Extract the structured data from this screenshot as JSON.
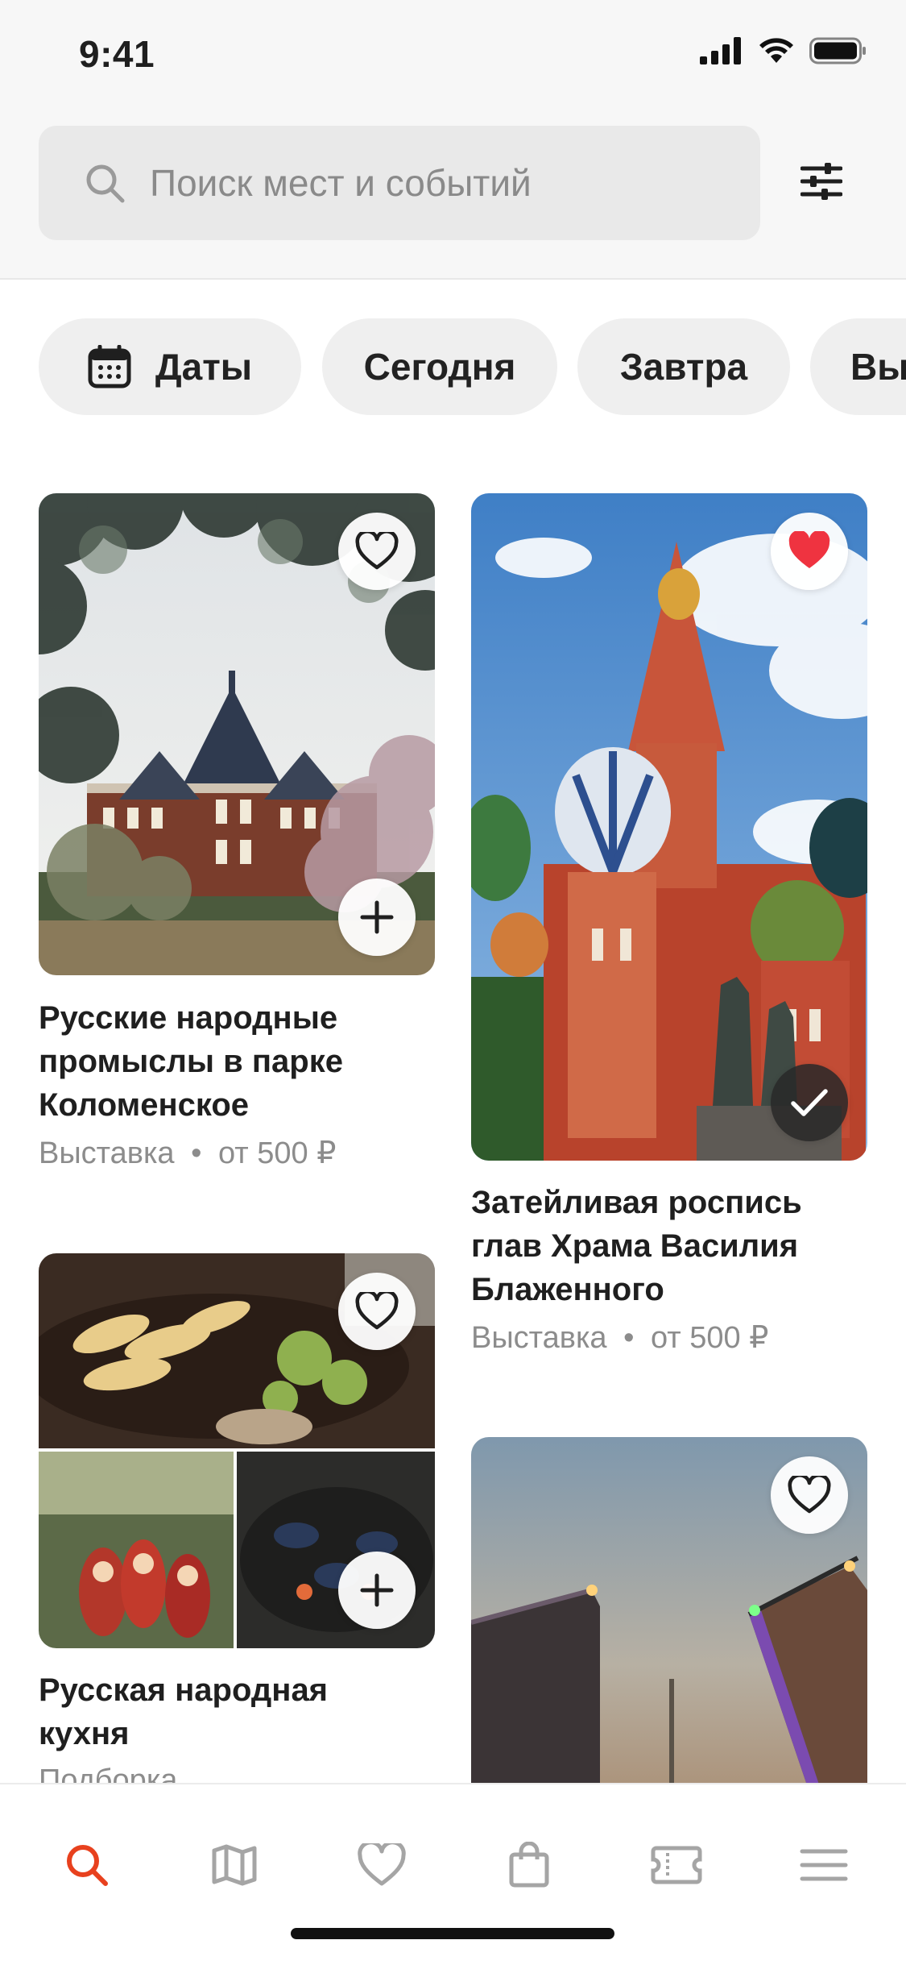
{
  "status_bar": {
    "time": "9:41"
  },
  "search": {
    "placeholder": "Поиск мест и событий"
  },
  "filters": {
    "chips": [
      {
        "label": "Даты",
        "icon": "calendar-icon"
      },
      {
        "label": "Сегодня"
      },
      {
        "label": "Завтра"
      },
      {
        "label": "Вых"
      }
    ]
  },
  "cards": [
    {
      "title_lines": [
        "Русские народные",
        "промыслы в парке",
        "Коломенское"
      ],
      "type": "Выставка",
      "price": "от 500 ₽",
      "favorite": false,
      "action": "add"
    },
    {
      "title_lines": [
        "Затейливая роспись",
        "глав Храма Василия",
        "Блаженного"
      ],
      "type": "Выставка",
      "price": "от 500 ₽",
      "favorite": true,
      "action": "added"
    },
    {
      "title_lines": [
        "Русская народная",
        "кухня"
      ],
      "type": "Подборка",
      "favorite": false,
      "action": "add"
    },
    {
      "favorite": false
    }
  ],
  "separator": "•",
  "tabbar": {
    "items": [
      {
        "name": "search",
        "icon": "search-icon",
        "active": true
      },
      {
        "name": "map",
        "icon": "map-icon"
      },
      {
        "name": "favorites",
        "icon": "heart-icon"
      },
      {
        "name": "cart",
        "icon": "bag-icon"
      },
      {
        "name": "tickets",
        "icon": "ticket-icon"
      },
      {
        "name": "menu",
        "icon": "menu-icon"
      }
    ]
  },
  "colors": {
    "accent": "#e8411e",
    "favorite": "#ef3340",
    "inactive_icon": "#a5a5a5"
  }
}
